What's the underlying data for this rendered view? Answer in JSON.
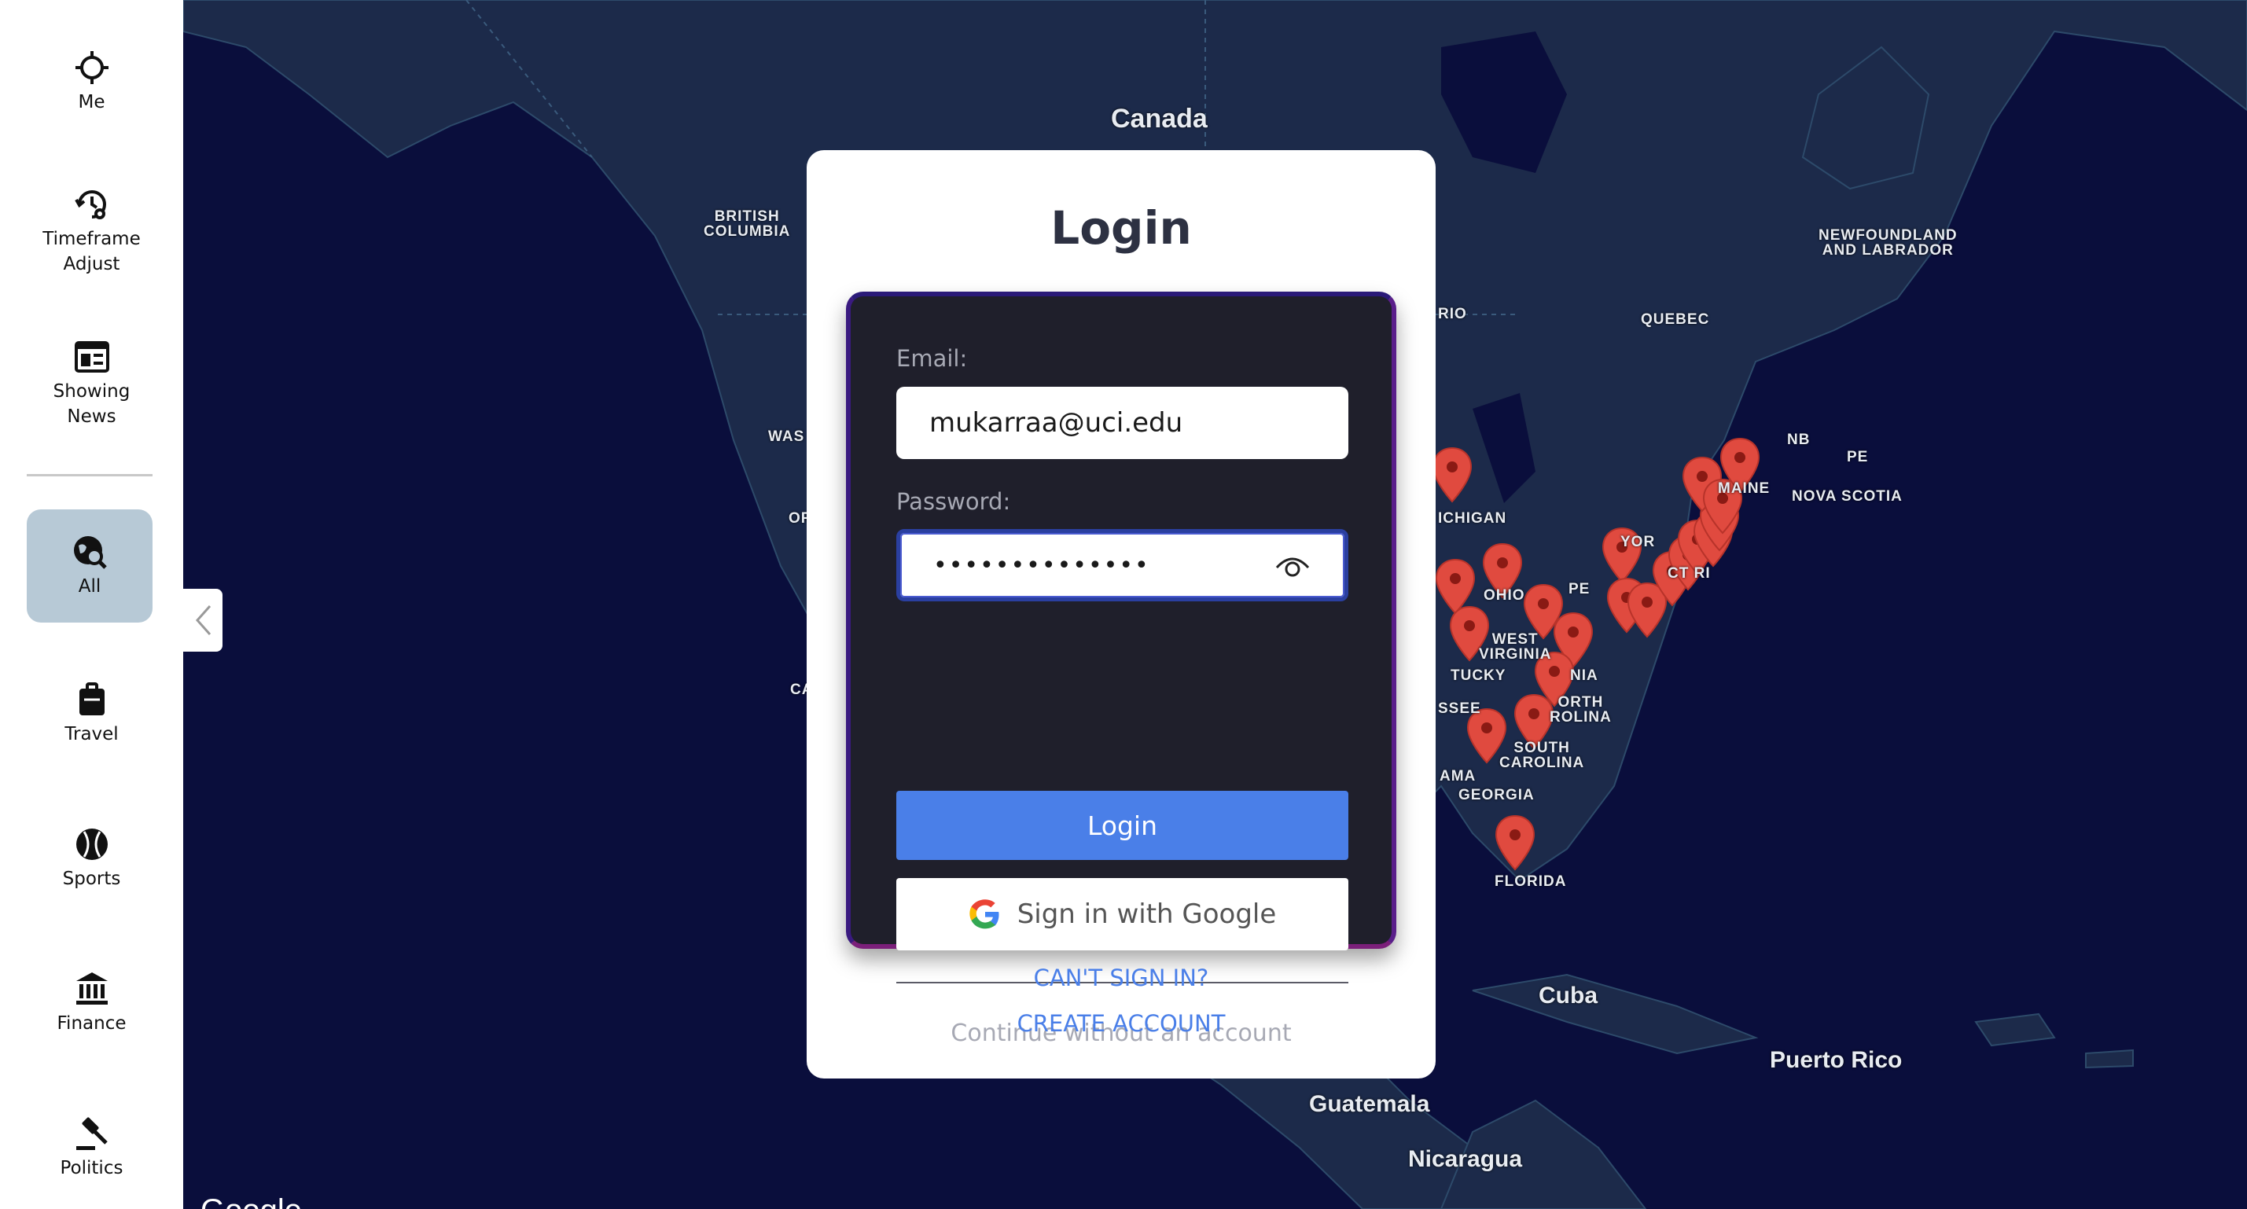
{
  "sidebar": {
    "items": [
      {
        "label": "Me",
        "icon": "crosshair-icon"
      },
      {
        "label": "Timeframe\nAdjust",
        "icon": "history-gear-icon"
      },
      {
        "label": "Showing\nNews",
        "icon": "newspaper-icon"
      },
      {
        "label": "All",
        "icon": "globe-search-icon",
        "active": true
      },
      {
        "label": "Travel",
        "icon": "luggage-icon"
      },
      {
        "label": "Sports",
        "icon": "sports-ball-icon"
      },
      {
        "label": "Finance",
        "icon": "bank-icon"
      },
      {
        "label": "Politics",
        "icon": "gavel-icon"
      }
    ]
  },
  "map": {
    "labels": {
      "canada": "Canada",
      "british_columbia": "BRITISH\nCOLUMBIA",
      "ontario": "RIO",
      "quebec": "QUEBEC",
      "newfoundland": "NEWFOUNDLAND\nAND LABRADOR",
      "nb": "NB",
      "pe": "PE",
      "nova_scotia": "NOVA SCOTIA",
      "maine": "MAINE",
      "michigan": "ICHIGAN",
      "ohio": "OHIO",
      "west_virginia": "WEST\nVIRGINIA",
      "kentucky": "TUCKY",
      "tennessee": "SSEE",
      "north_carolina": "ORTH\nROLINA",
      "south_carolina": "SOUTH\nCAROLINA",
      "georgia": "GEORGIA",
      "alabama": "AMA",
      "florida": "FLORIDA",
      "cuba": "Cuba",
      "puerto_rico": "Puerto Rico",
      "guatemala": "Guatemala",
      "nicaragua": "Nicaragua",
      "washington": "WAS",
      "oregon": "OR",
      "california": "CA",
      "new_york": "YOR",
      "ct_ri": "CT RI",
      "pa": "PE",
      "va": "NIA"
    },
    "attribution": "Google",
    "colors": {
      "water": "#0a0e3c",
      "land": "#1c2a4a",
      "pin": "#e04a3f"
    }
  },
  "login": {
    "title": "Login",
    "email_label": "Email:",
    "email_value": "mukarraa@uci.edu",
    "password_label": "Password:",
    "password_value": "••••••••••••••",
    "login_button": "Login",
    "google_button": "Sign in with Google",
    "continue_text": "Continue without an account",
    "cant_sign_in": "CAN'T SIGN IN?",
    "create_account": "CREATE ACCOUNT"
  }
}
